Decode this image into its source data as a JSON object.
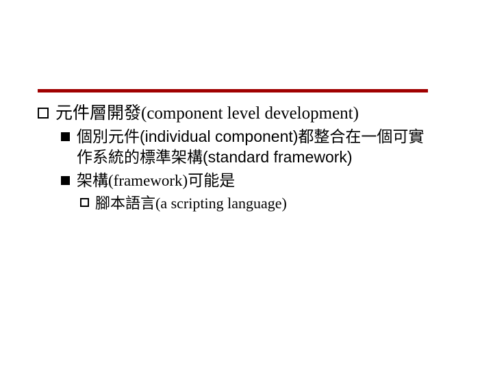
{
  "colors": {
    "rule": "#a00000"
  },
  "outline": {
    "level1": {
      "text": "元件層開發(component level development)"
    },
    "level2": [
      {
        "text": "個別元件(individual component)都整合在一個可實作系統的標準架構(standard framework)",
        "children": []
      },
      {
        "text": "架構(framework)可能是",
        "serif": true,
        "children": [
          {
            "text": "腳本語言(a scripting language)"
          }
        ]
      }
    ]
  }
}
